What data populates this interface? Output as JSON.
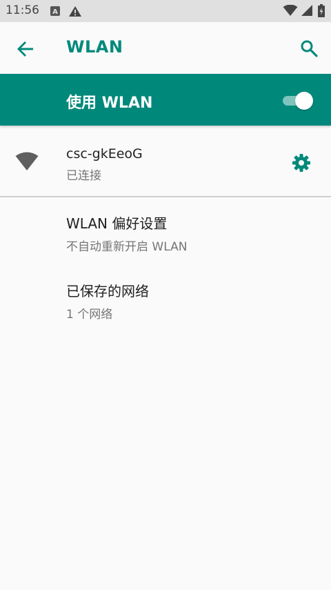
{
  "status_bar": {
    "time": "11:56",
    "left_icons": [
      "a-box-icon",
      "warning-icon"
    ],
    "right_icons": [
      "wifi-signal-icon",
      "cell-signal-icon",
      "battery-charging-icon"
    ]
  },
  "app_bar": {
    "title": "WLAN",
    "back_icon": "arrow-left-icon",
    "search_icon": "search-icon"
  },
  "master_switch": {
    "label": "使用 WLAN",
    "enabled": true,
    "background_color": "#00897b"
  },
  "connected_network": {
    "ssid": "csc-gkEeoG",
    "status": "已连接",
    "icon": "wifi-icon",
    "settings_icon": "gear-icon"
  },
  "menu_items": [
    {
      "title": "WLAN 偏好设置",
      "subtitle": "不自动重新开启 WLAN"
    },
    {
      "title": "已保存的网络",
      "subtitle": "1 个网络"
    }
  ],
  "colors": {
    "accent": "#00897b",
    "background": "#fafafa",
    "status_bar": "#e0e0e0"
  }
}
